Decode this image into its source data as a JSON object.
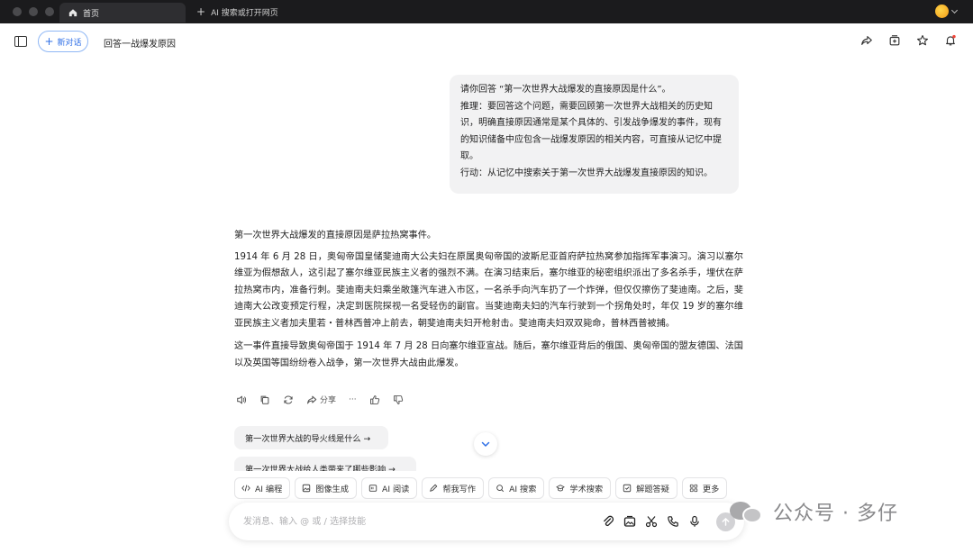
{
  "titlebar": {
    "tab_home": "首页",
    "tab_new": "AI 搜索或打开网页"
  },
  "header": {
    "new_chat": "新对话",
    "title": "回答一战爆发原因"
  },
  "user_message": {
    "lines": [
      "请你回答 “第一次世界大战爆发的直接原因是什么”。",
      "推理：要回答这个问题，需要回顾第一次世界大战相关的历史知识，明确直接原因通常是某个具体的、引发战争爆发的事件，现有的知识储备中应包含一战爆发原因的相关内容，可直接从记忆中提取。",
      "行动：从记忆中搜索关于第一次世界大战爆发直接原因的知识。"
    ]
  },
  "answer": {
    "p1": "第一次世界大战爆发的直接原因是萨拉热窝事件。",
    "p2": "1914 年 6 月 28 日，奥匈帝国皇储斐迪南大公夫妇在原属奥匈帝国的波斯尼亚首府萨拉热窝参加指挥军事演习。演习以塞尔维亚为假想敌人，这引起了塞尔维亚民族主义者的强烈不满。在演习结束后，塞尔维亚的秘密组织派出了多名杀手，埋伏在萨拉热窝市内，准备行刺。斐迪南夫妇乘坐敞篷汽车进入市区，一名杀手向汽车扔了一个炸弹，但仅仅擦伤了斐迪南。之后，斐迪南大公改变预定行程，决定到医院探视一名受轻伤的副官。当斐迪南夫妇的汽车行驶到一个拐角处时，年仅 19 岁的塞尔维亚民族主义者加夫里若・普林西普冲上前去，朝斐迪南夫妇开枪射击。斐迪南夫妇双双毙命，普林西普被捕。",
    "p3": "这一事件直接导致奥匈帝国于 1914 年 7 月 28 日向塞尔维亚宣战。随后，塞尔维亚背后的俄国、奥匈帝国的盟友德国、法国以及英国等国纷纷卷入战争，第一次世界大战由此爆发。"
  },
  "actions": {
    "share": "分享",
    "more": "···"
  },
  "suggestions": [
    "第一次世界大战的导火线是什么 →",
    "第一次世界大战给人类带来了哪些影响 →"
  ],
  "skills": [
    {
      "label": "AI 编程",
      "icon": "code-icon"
    },
    {
      "label": "图像生成",
      "icon": "image-icon"
    },
    {
      "label": "AI 阅读",
      "icon": "read-icon"
    },
    {
      "label": "帮我写作",
      "icon": "pen-icon"
    },
    {
      "label": "AI 搜索",
      "icon": "search-icon"
    },
    {
      "label": "学术搜索",
      "icon": "scholar-icon"
    },
    {
      "label": "解题答疑",
      "icon": "solve-icon"
    },
    {
      "label": "更多",
      "icon": "grid-icon"
    }
  ],
  "input": {
    "placeholder": "发消息、输入 @ 或 / 选择技能"
  },
  "watermark": {
    "text": "公众号 · 多仔"
  },
  "colors": {
    "accent": "#2f6fe6",
    "bubble": "#f2f2f3",
    "titlebar": "#1b1b1d"
  }
}
